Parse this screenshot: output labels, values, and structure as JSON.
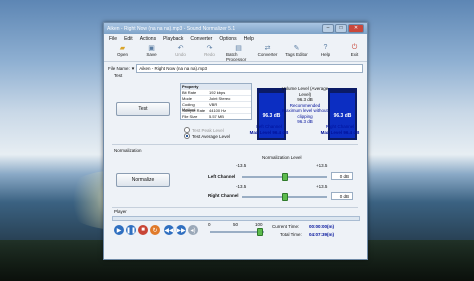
{
  "window": {
    "title": "Aiken - Right Now (na na na).mp3 - Sound Normalizer 5.1"
  },
  "menu": [
    "File",
    "Edit",
    "Actions",
    "Playback",
    "Converter",
    "Options",
    "Help"
  ],
  "toolbar": [
    {
      "label": "Open",
      "icon": "folder-open-icon"
    },
    {
      "label": "Save",
      "icon": "save-icon"
    },
    {
      "label": "Undo",
      "icon": "undo-icon"
    },
    {
      "label": "Redo",
      "icon": "redo-icon"
    },
    {
      "label": "Batch Processor",
      "icon": "batch-processor-icon"
    },
    {
      "label": "Converter",
      "icon": "converter-icon"
    },
    {
      "label": "Tags Editor",
      "icon": "tags-editor-icon"
    },
    {
      "label": "Help",
      "icon": "help-icon"
    },
    {
      "label": "Exit",
      "icon": "exit-icon"
    }
  ],
  "file": {
    "label": "File Name:",
    "value": "Aiken - Right Now (na na na).mp3"
  },
  "test": {
    "section": "Test",
    "button": "Test",
    "property_header": "Property",
    "properties": [
      [
        "Bit Rate",
        "192 kbps"
      ],
      [
        "Mode",
        "Joint Stereo"
      ],
      [
        "Coding Method",
        "VBR"
      ],
      [
        "Sample Rate",
        "44100 Hz"
      ],
      [
        "File Size",
        "5.57 MB"
      ]
    ],
    "radio_peak": "Test Peak Level",
    "radio_average": "Test Average Level"
  },
  "meters": {
    "left": {
      "value": "96.3 dB",
      "label": "Left Channel",
      "max": "Max Level 96.4 dB"
    },
    "right": {
      "value": "96.3 dB",
      "label": "Right Channel",
      "max": "Max Level 96.4 dB"
    },
    "volume_title": "Volume Level (Average Level)",
    "volume_value": "96.3 dB",
    "recommended": "Recommended Maximum level without clipping",
    "recommended_value": "96.3 dB"
  },
  "normalization": {
    "section": "Normalization",
    "button": "Normalize",
    "title": "Normalization Level",
    "left_label": "Left Channel",
    "right_label": "Right Channel",
    "left": {
      "min": "-13.5",
      "max": "+13.5",
      "value": "0 dB",
      "level": 0.5
    },
    "right": {
      "min": "-13.5",
      "max": "+13.5",
      "value": "0 dB",
      "level": 0.5
    }
  },
  "player": {
    "section": "Player",
    "vol_labels": [
      "0",
      "50",
      "100"
    ],
    "current_label": "Current Time:",
    "current": "00:00:00(m)",
    "total_label": "Total Time:",
    "total": "04:07:39(m)"
  },
  "colors": {
    "meter": "#0c2ec2",
    "accent": "#00119a"
  }
}
